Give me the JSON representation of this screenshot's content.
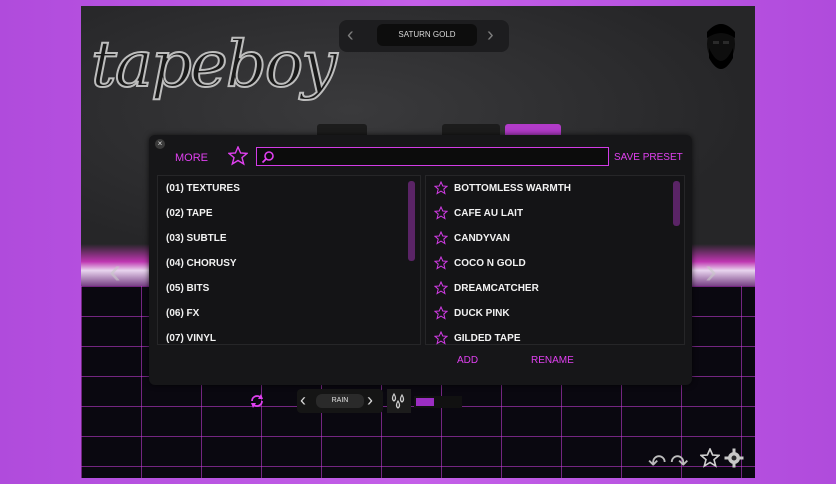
{
  "app": {
    "logo_text": "tapeboy",
    "current_preset": "SATURN GOLD",
    "accent_color": "#e040f0"
  },
  "modal": {
    "close_icon": "close-icon",
    "more_label": "MORE",
    "search_placeholder": "",
    "save_preset_label": "SAVE PRESET",
    "categories": [
      "(01) TEXTURES",
      "(02) TAPE",
      "(03) SUBTLE",
      "(04) CHORUSY",
      "(05) BITS",
      "(06) FX",
      "(07) VINYL"
    ],
    "presets": [
      "BOTTOMLESS WARMTH",
      "CAFE AU LAIT",
      "CANDYVAN",
      "COCO N GOLD",
      "DREAMCATCHER",
      "DUCK PINK",
      "GILDED TAPE"
    ],
    "add_label": "ADD",
    "rename_label": "RENAME"
  },
  "bottom_bar": {
    "noise_name": "RAIN",
    "level_percent": 40
  }
}
